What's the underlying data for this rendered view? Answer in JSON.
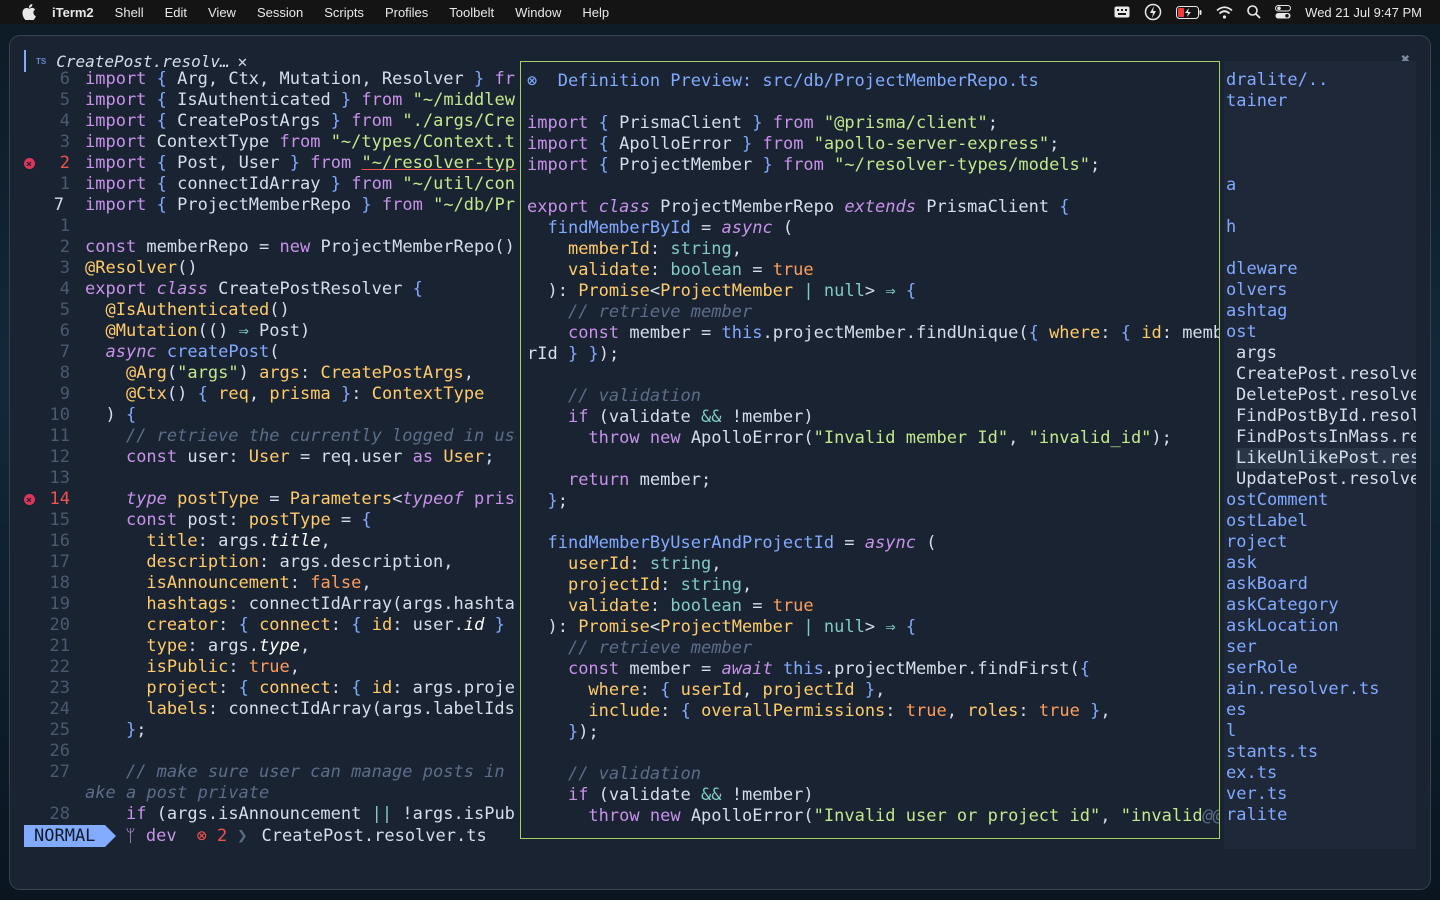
{
  "menubar": {
    "app": "iTerm2",
    "items": [
      "Shell",
      "Edit",
      "View",
      "Session",
      "Scripts",
      "Profiles",
      "Toolbelt",
      "Window",
      "Help"
    ],
    "clock": "Wed 21 Jul  9:47 PM"
  },
  "tab": {
    "badge": "TS",
    "title": "CreatePost.resolv…"
  },
  "statusbar": {
    "mode": "NORMAL",
    "branch": "ᛘ dev",
    "errors": "⊗ 2",
    "sep": "〉",
    "file": "CreatePost.resolver.ts"
  },
  "preview": {
    "title": "⊗  Definition Preview: src/db/ProjectMemberRepo.ts"
  },
  "explorer": {
    "rows": [
      "dralite/..",
      "tainer",
      "",
      "",
      "",
      "a",
      "",
      "h",
      "",
      "dleware",
      "olvers",
      "ashtag",
      "ost",
      "args",
      "CreatePost.resolve",
      "DeletePost.resolve",
      "FindPostById.resol",
      "FindPostsInMass.re",
      "LikeUnlikePost.res",
      "UpdatePost.resolve",
      "ostComment",
      "ostLabel",
      "roject",
      "ask",
      "askBoard",
      "askCategory",
      "askLocation",
      "ser",
      "serRole",
      "ain.resolver.ts",
      "es",
      "l",
      "stants.ts",
      "ex.ts",
      "ver.ts",
      "ralite"
    ]
  }
}
